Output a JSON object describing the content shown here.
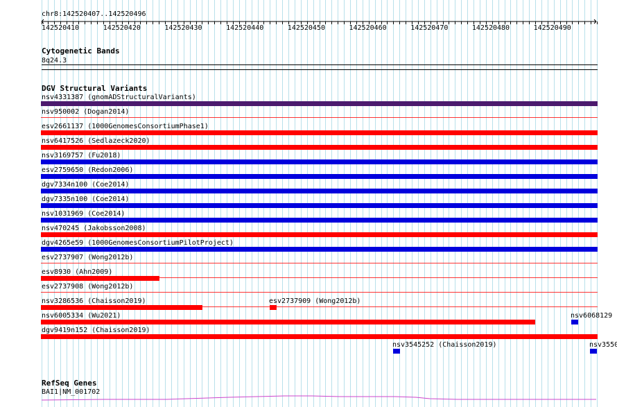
{
  "ruler": {
    "location": "chr8:142520407..142520496",
    "ticks": [
      "142520410",
      "142520420",
      "142520430",
      "142520440",
      "142520450",
      "142520460",
      "142520470",
      "142520480",
      "142520490"
    ]
  },
  "cytoband_track": {
    "title": "Cytogenetic Bands",
    "band": "8q24.3"
  },
  "dgv_track": {
    "title": "DGV Structural Variants",
    "rows": [
      {
        "label": "nsv4331387 (gnomADStructuralVariants)",
        "color": "#4b1a6e"
      },
      {
        "label": "nsv950002 (Dogan2014)",
        "color": ""
      },
      {
        "label": "esv2661137 (1000GenomesConsortiumPhase1)",
        "color": "#ff0000"
      },
      {
        "label": "nsv6417526 (Sedlazeck2020)",
        "color": "#ff0000"
      },
      {
        "label": "nsv3169757 (Fu2018)",
        "color": "#0000dd"
      },
      {
        "label": "esv2759650 (Redon2006)",
        "color": "#0000dd"
      },
      {
        "label": "dgv7334n100 (Coe2014)",
        "color": "#0000dd"
      },
      {
        "label": "dgv7335n100 (Coe2014)",
        "color": "#0000dd"
      },
      {
        "label": "nsv1031969 (Coe2014)",
        "color": "#0000dd"
      },
      {
        "label": "nsv470245 (Jakobsson2008)",
        "color": "#ff0000"
      },
      {
        "label": "dgv4265e59 (1000GenomesConsortiumPilotProject)",
        "color": "#0000dd"
      },
      {
        "label": "esv2737907 (Wong2012b)",
        "color": ""
      },
      {
        "label": "esv8930 (Ahn2009)",
        "color": "#ff0000"
      },
      {
        "label": "esv2737908 (Wong2012b)",
        "color": ""
      },
      {
        "label": "nsv3286536 (Chaisson2019)",
        "color": "#ff0000"
      },
      {
        "label": "esv2737909 (Wong2012b)",
        "color": "#ff0000"
      },
      {
        "label": "nsv6005334 (Wu2021)",
        "color": "#ff0000"
      },
      {
        "label": "nsv6068129",
        "color": "#0000dd"
      },
      {
        "label": "dgv9419n152 (Chaisson2019)",
        "color": "#ff0000"
      },
      {
        "label": "nsv3545252 (Chaisson2019)",
        "color": "#0000dd"
      },
      {
        "label": "nsv3550",
        "color": "#0000dd"
      }
    ]
  },
  "refseq_track": {
    "title": "RefSeq Genes",
    "transcript": "BAI1|NM_001702",
    "color": "#cc44cc"
  }
}
